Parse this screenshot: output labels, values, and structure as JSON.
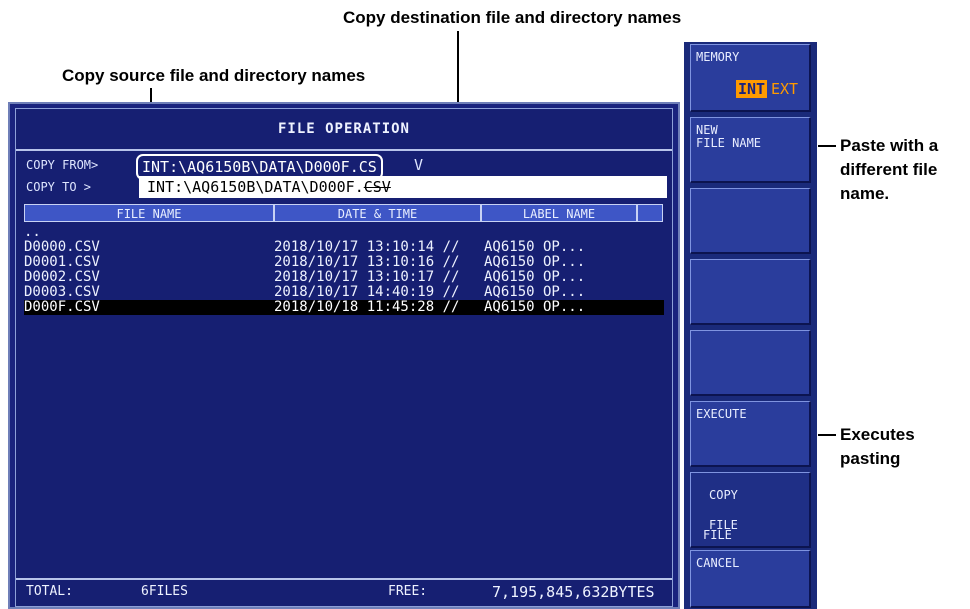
{
  "annotations": {
    "dest": "Copy destination file and directory names",
    "source": "Copy source file and directory names",
    "paste_a": "Paste with a",
    "paste_b": "different file",
    "paste_c": "name.",
    "exec_a": "Executes",
    "exec_b": "pasting"
  },
  "screen": {
    "title": "FILE OPERATION",
    "copy_from_label": "COPY FROM>",
    "copy_from_value": "INT:\\AQ6150B\\DATA\\D000F.CS",
    "copy_from_tail": "V",
    "copy_to_label": "COPY TO  >",
    "copy_to_value": "INT:\\AQ6150B\\DATA\\D000F.",
    "copy_to_ext": "CSV",
    "columns": [
      "FILE NAME",
      "DATE & TIME",
      "LABEL NAME"
    ],
    "files": [
      {
        "name": "..",
        "date": "",
        "label": ""
      },
      {
        "name": "D0000.CSV",
        "date": "2018/10/17 13:10:14 //",
        "label": "AQ6150 OP..."
      },
      {
        "name": "D0001.CSV",
        "date": "2018/10/17 13:10:16 //",
        "label": "AQ6150 OP..."
      },
      {
        "name": "D0002.CSV",
        "date": "2018/10/17 13:10:17 //",
        "label": "AQ6150 OP..."
      },
      {
        "name": "D0003.CSV",
        "date": "2018/10/17 14:40:19 //",
        "label": "AQ6150 OP..."
      },
      {
        "name": "D000F.CSV",
        "date": "2018/10/18 11:45:28 //",
        "label": "AQ6150 OP...",
        "selected": true
      }
    ],
    "total_label": "TOTAL:",
    "total_value": "6FILES",
    "free_label": "FREE:",
    "free_value": "7,195,845,632BYTES"
  },
  "softkeys": {
    "memory_label": "MEMORY",
    "memory_int": "INT",
    "memory_ext": "EXT",
    "new_file_name_1": "NEW",
    "new_file_name_2": "FILE NAME",
    "execute": "EXECUTE",
    "copy": "COPY",
    "file_1": "FILE",
    "file_2": "FILE",
    "cancel": "CANCEL"
  },
  "colors": {
    "accent": "#ff9a00",
    "screen_bg": "#1a237e",
    "selection": "#000000"
  }
}
